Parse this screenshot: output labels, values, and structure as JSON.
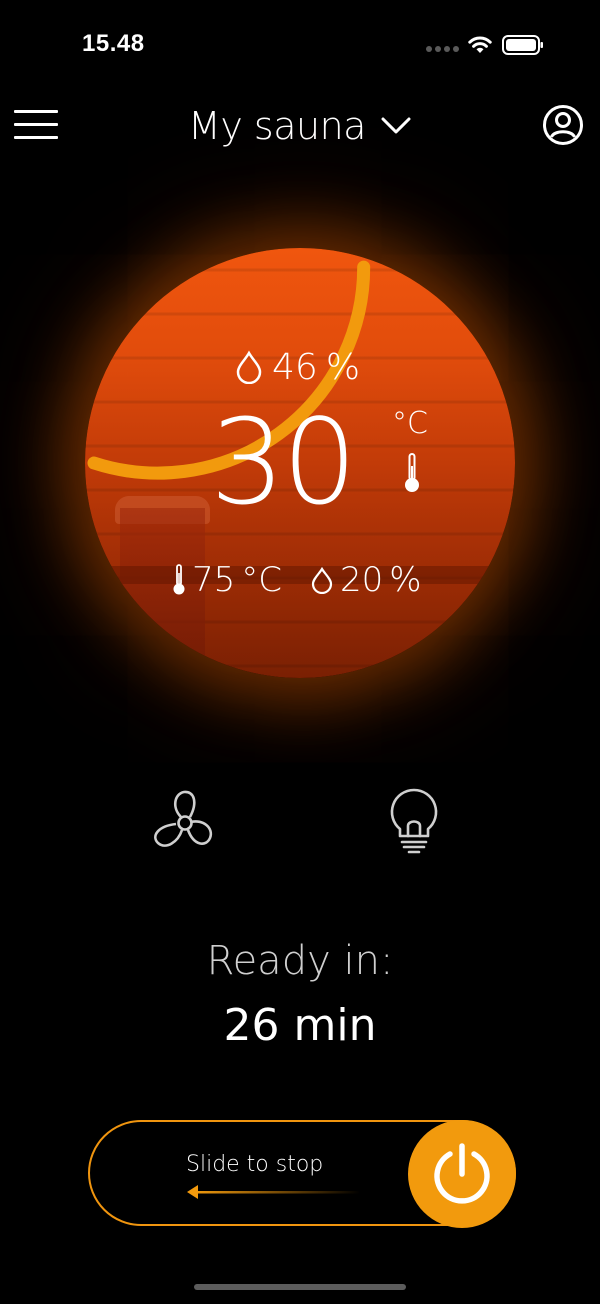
{
  "status_bar": {
    "time": "15.48"
  },
  "header": {
    "title": "My sauna",
    "menu_icon": "hamburger-menu-icon",
    "dropdown_icon": "chevron-down-icon",
    "profile_icon": "user-profile-icon"
  },
  "sauna": {
    "humidity_now": "46",
    "humidity_unit": "%",
    "temperature_now": "30",
    "temperature_unit": "°C",
    "target_temperature": "75",
    "target_temperature_unit": "°C",
    "target_humidity": "20",
    "target_humidity_unit": "%",
    "heating_progress": 0.3
  },
  "controls": {
    "fan_icon": "fan-icon",
    "light_icon": "light-bulb-icon"
  },
  "ready": {
    "label": "Ready in:",
    "value": "26 min"
  },
  "slider": {
    "label": "Slide to stop",
    "power_icon": "power-icon"
  },
  "colors": {
    "accent": "#f29a0d",
    "background": "#000000",
    "sauna_glow": "#f0560e"
  }
}
